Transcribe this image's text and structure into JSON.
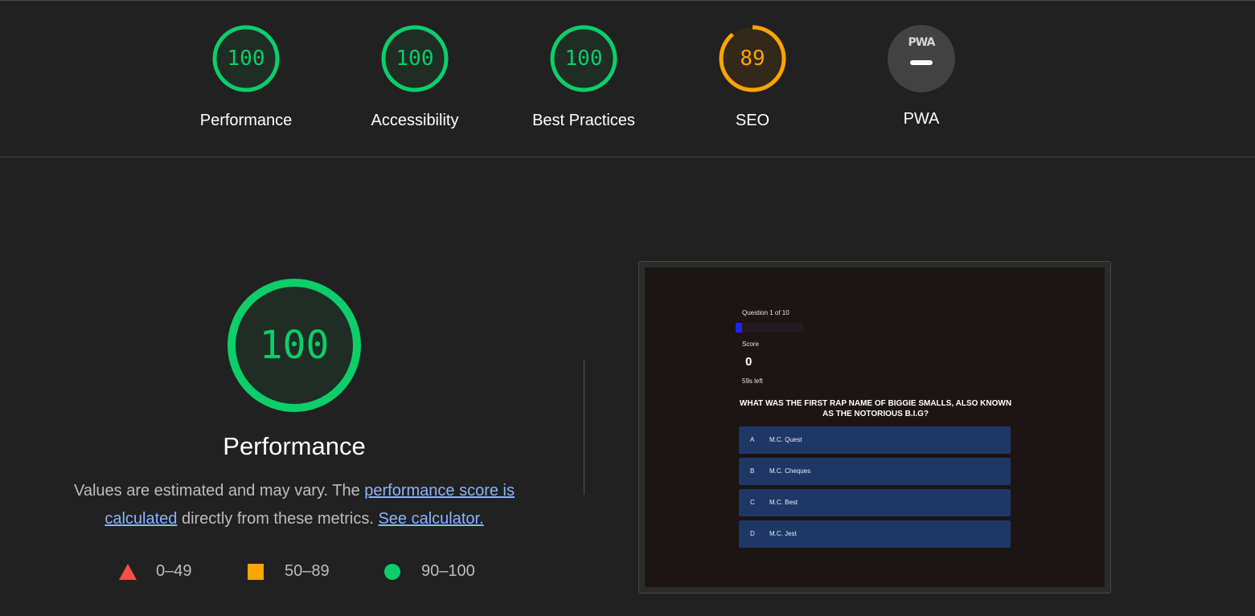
{
  "categories": [
    {
      "label": "Performance",
      "score": "100",
      "value": 100,
      "status": "pass"
    },
    {
      "label": "Accessibility",
      "score": "100",
      "value": 100,
      "status": "pass"
    },
    {
      "label": "Best Practices",
      "score": "100",
      "value": 100,
      "status": "pass"
    },
    {
      "label": "SEO",
      "score": "89",
      "value": 89,
      "status": "average"
    },
    {
      "label": "PWA",
      "logo": "PWA",
      "status": "na"
    }
  ],
  "main": {
    "score": "100",
    "score_value": 100,
    "title": "Performance",
    "desc_prefix": "Values are estimated and may vary. The ",
    "link_score": "performance score is calculated",
    "desc_mid": " directly from these metrics. ",
    "link_calc": "See calculator."
  },
  "legend": [
    {
      "range": "0–49",
      "icon": "fail-triangle-icon"
    },
    {
      "range": "50–89",
      "icon": "average-square-icon"
    },
    {
      "range": "90–100",
      "icon": "pass-circle-icon"
    }
  ],
  "colors": {
    "pass": "#0cce6b",
    "average": "#ffa400",
    "fail": "#ff4e42",
    "link": "#8ab4f8"
  },
  "screenshot": {
    "question_counter": "Question 1 of 10",
    "progress": 0.1,
    "score_label": "Score",
    "score_value": "0",
    "time_left": "59s left",
    "question": "WHAT WAS THE FIRST RAP NAME OF BIGGIE SMALLS, ALSO KNOWN AS THE NOTORIOUS B.I.G?",
    "answers": [
      {
        "letter": "A",
        "text": "M.C. Quest"
      },
      {
        "letter": "B",
        "text": "M.C. Cheques"
      },
      {
        "letter": "C",
        "text": "M.C. Best"
      },
      {
        "letter": "D",
        "text": "M.C. Jest"
      }
    ]
  }
}
